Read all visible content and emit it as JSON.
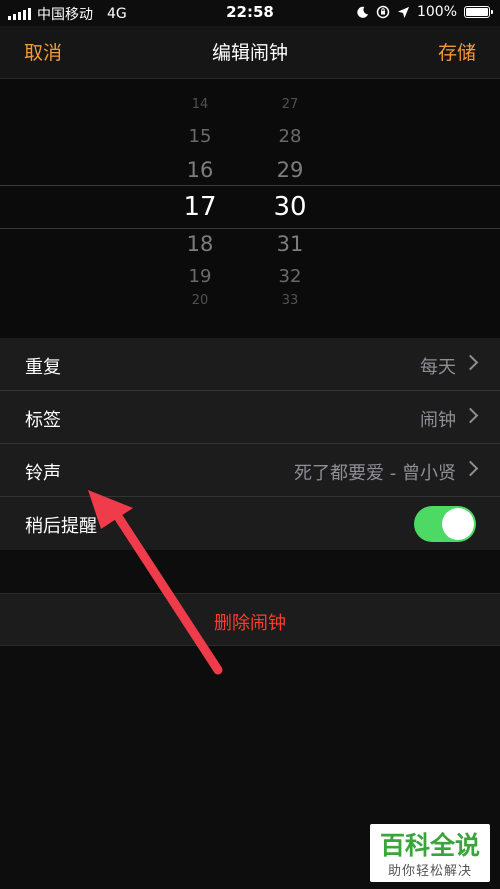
{
  "status_bar": {
    "carrier": "中国移动",
    "network": "4G",
    "time": "22:58",
    "battery": "100%",
    "battery_level": 1.0
  },
  "nav": {
    "cancel": "取消",
    "title": "编辑闹钟",
    "save": "存储"
  },
  "picker": {
    "hours": [
      "14",
      "15",
      "16",
      "17",
      "18",
      "19",
      "20"
    ],
    "minutes": [
      "27",
      "28",
      "29",
      "30",
      "31",
      "32",
      "33"
    ],
    "selected_hour": "17",
    "selected_minute": "30"
  },
  "settings": {
    "repeat": {
      "label": "重复",
      "value": "每天"
    },
    "label": {
      "label": "标签",
      "value": "闹钟"
    },
    "sound": {
      "label": "铃声",
      "value": "死了都要爱 - 曾小贤"
    },
    "snooze": {
      "label": "稍后提醒",
      "enabled": true
    }
  },
  "delete_label": "删除闹钟",
  "watermark": {
    "main": "百科全说",
    "sub": "助你轻松解决"
  },
  "colors": {
    "accent": "#f19a37",
    "toggle_on": "#4cd964",
    "destructive": "#ff3b30",
    "annotation_arrow": "#ef3b4a"
  }
}
